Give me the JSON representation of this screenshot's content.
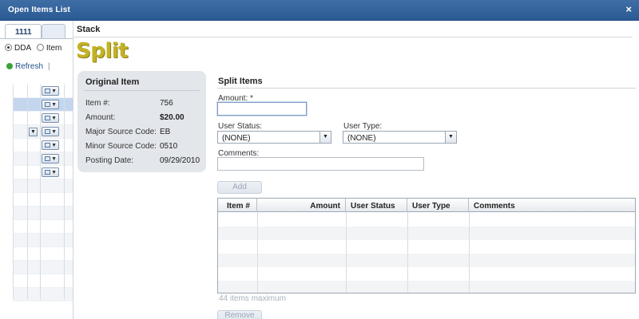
{
  "window": {
    "title": "Open Items List",
    "close_glyph": "×"
  },
  "left_panel": {
    "tabs": [
      "1111",
      ""
    ],
    "radios": [
      {
        "label": "DDA",
        "selected": true
      },
      {
        "label": "Item",
        "selected": false
      }
    ],
    "refresh_label": "Refresh",
    "separator": "|"
  },
  "main": {
    "stack_label": "Stack",
    "logo_text": "Split",
    "original_item": {
      "title": "Original Item",
      "fields": [
        {
          "label": "Item #:",
          "value": "756"
        },
        {
          "label": "Amount:",
          "value": "$20.00"
        },
        {
          "label": "Major Source Code:",
          "value": "EB"
        },
        {
          "label": "Minor Source Code:",
          "value": "0510"
        },
        {
          "label": "Posting Date:",
          "value": "09/29/2010"
        }
      ]
    },
    "split_items": {
      "title": "Split Items",
      "amount_label": "Amount: *",
      "amount_value": "",
      "user_status_label": "User Status:",
      "user_status_value": "(NONE)",
      "user_type_label": "User Type:",
      "user_type_value": "(NONE)",
      "comments_label": "Comments:",
      "comments_value": "",
      "add_button": "Add",
      "table_headers": [
        "Item #",
        "Amount",
        "User Status",
        "User Type",
        "Comments"
      ],
      "hint": "44 items maximum",
      "remove_button": "Remove"
    }
  },
  "colors": {
    "titlebar": "#2b5a94",
    "logo": "#c2b226",
    "selected_row": "#c4d6ee"
  },
  "icons": [
    "close-icon",
    "refresh-icon",
    "chevron-down-icon",
    "edit-icon"
  ]
}
